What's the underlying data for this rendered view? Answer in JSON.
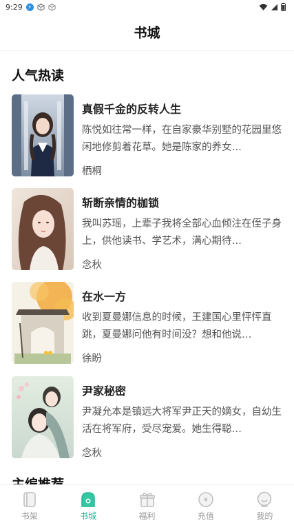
{
  "status_bar": {
    "time": "9:29"
  },
  "header": {
    "title": "书城"
  },
  "section_popular": {
    "title": "人气热读"
  },
  "books": [
    {
      "title": "真假千金的反转人生",
      "desc": "陈悦如往常一样，在自家豪华别墅的花园里悠闲地修剪着花草。她是陈家的养女…",
      "author": "栖桐"
    },
    {
      "title": "斩断亲情的枷锁",
      "desc": "我叫苏瑶，上辈子我将全部心血倾注在侄子身上，供他读书、学艺术，满心期待…",
      "author": "念秋"
    },
    {
      "title": "在水一方",
      "desc": "收到夏曼娜信息的时候，王建国心里怦怦直跳，夏曼娜问他有时间没？想和他说…",
      "author": "徐盼"
    },
    {
      "title": "尹家秘密",
      "desc": "尹凝允本是镇远大将军尹正天的嫡女，自幼生活在将军府，受尽宠爱。她生得聪…",
      "author": "念秋"
    }
  ],
  "section_editor": {
    "title": "主编推荐"
  },
  "tabs": [
    {
      "label": "书架",
      "icon": "book-icon"
    },
    {
      "label": "书城",
      "icon": "store-icon"
    },
    {
      "label": "福利",
      "icon": "gift-icon"
    },
    {
      "label": "充值",
      "icon": "coin-icon"
    },
    {
      "label": "我的",
      "icon": "profile-icon"
    }
  ],
  "active_tab": "书城",
  "colors": {
    "accent": "#1fb896",
    "inactive": "#999999"
  }
}
